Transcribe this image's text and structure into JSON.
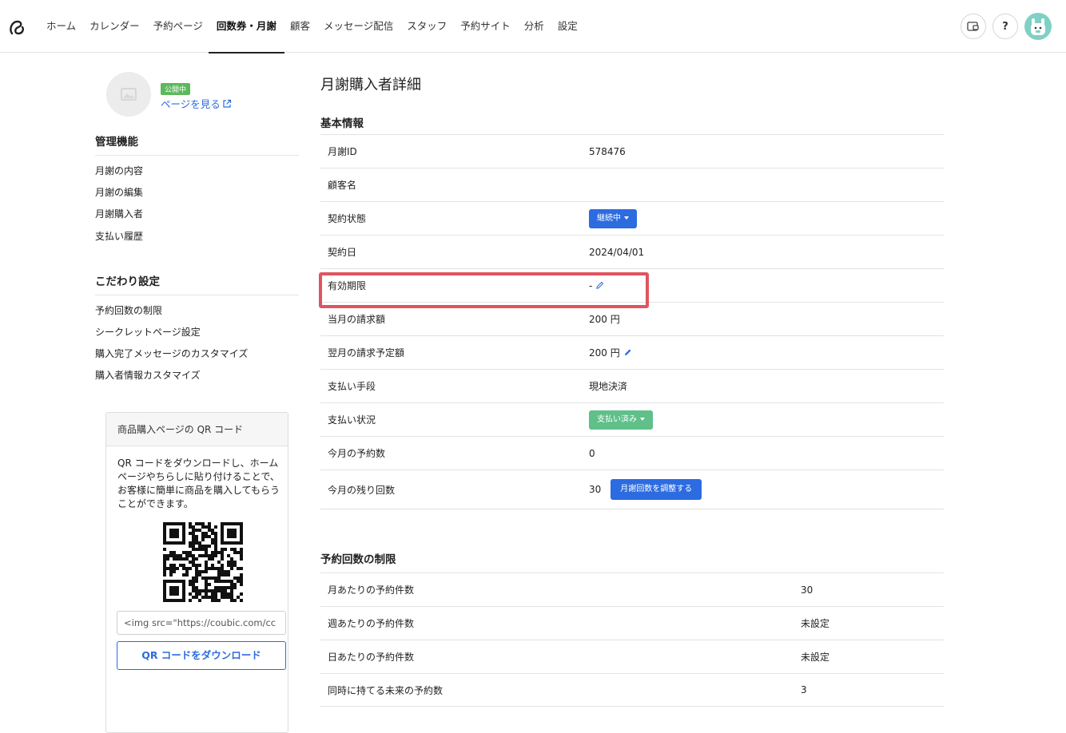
{
  "nav": {
    "items": [
      "ホーム",
      "カレンダー",
      "予約ページ",
      "回数券・月謝",
      "顧客",
      "メッセージ配信",
      "スタッフ",
      "予約サイト",
      "分析",
      "設定"
    ],
    "active_index": 3,
    "help_label": "?",
    "icons": [
      "logo-icon",
      "wallet-icon",
      "help-icon",
      "avatar"
    ]
  },
  "sidebar": {
    "status_badge": "公開中",
    "view_link": "ページを見る",
    "sections": [
      {
        "title": "管理機能",
        "links": [
          "月謝の内容",
          "月謝の編集",
          "月謝購入者",
          "支払い履歴"
        ]
      },
      {
        "title": "こだわり設定",
        "links": [
          "予約回数の制限",
          "シークレットページ設定",
          "購入完了メッセージのカスタマイズ",
          "購入者情報カスタマイズ"
        ]
      }
    ],
    "qr": {
      "header": "商品購入ページの QR コード",
      "description": "QR コードをダウンロードし、ホームページやちらしに貼り付けることで、お客様に簡単に商品を購入してもらうことができます。",
      "embed_code": "<img src=\"https://coubic.com/cc",
      "download_label": "QR コードをダウンロード"
    }
  },
  "main": {
    "title": "月謝購入者詳細",
    "basic": {
      "title": "基本情報",
      "rows": [
        {
          "label": "月謝ID",
          "value": "578476"
        },
        {
          "label": "顧客名",
          "value": ""
        },
        {
          "label": "契約状態",
          "value": "継続中"
        },
        {
          "label": "契約日",
          "value": "2024/04/01"
        },
        {
          "label": "有効期限",
          "value": "-"
        },
        {
          "label": "当月の請求額",
          "value": "200 円"
        },
        {
          "label": "翌月の請求予定額",
          "value": "200 円"
        },
        {
          "label": "支払い手段",
          "value": "現地決済"
        },
        {
          "label": "支払い状況",
          "value": "支払い済み"
        },
        {
          "label": "今月の予約数",
          "value": "0"
        },
        {
          "label": "今月の残り回数",
          "value": "30",
          "button": "月謝回数を調整する"
        }
      ]
    },
    "limits": {
      "title": "予約回数の制限",
      "rows": [
        {
          "label": "月あたりの予約件数",
          "value": "30"
        },
        {
          "label": "週あたりの予約件数",
          "value": "未設定"
        },
        {
          "label": "日あたりの予約件数",
          "value": "未設定"
        },
        {
          "label": "同時に持てる未来の予約数",
          "value": "3"
        }
      ]
    }
  },
  "colors": {
    "accent": "#2c6be0",
    "green": "#5fc089",
    "highlight": "#e0545f"
  }
}
